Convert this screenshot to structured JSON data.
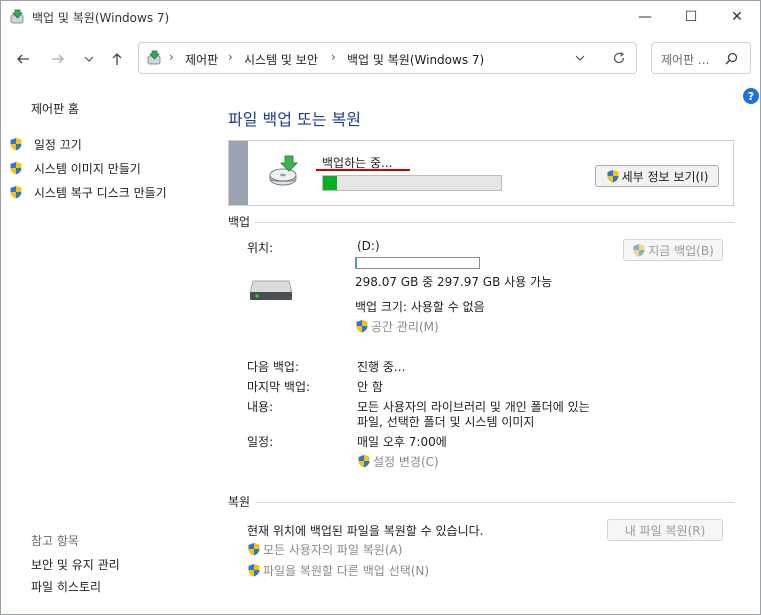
{
  "window": {
    "title": "백업 및 복원(Windows 7)",
    "minimize": "—",
    "maximize": "☐",
    "close": "✕"
  },
  "address": {
    "breadcrumbs": [
      "제어판",
      "시스템 및 보안",
      "백업 및 복원(Windows 7)"
    ],
    "search_placeholder": "제어판 ..."
  },
  "sidebar": {
    "home": "제어판 홈",
    "items": [
      {
        "label": "일정 끄기",
        "icon": "uac-shield-icon"
      },
      {
        "label": "시스템 이미지 만들기",
        "icon": "uac-shield-icon"
      },
      {
        "label": "시스템 복구 디스크 만들기",
        "icon": "uac-shield-icon"
      }
    ],
    "see_also_title": "참고 항목",
    "see_also": [
      "보안 및 유지 관리",
      "파일 히스토리"
    ]
  },
  "main": {
    "title": "파일 백업 또는 복원",
    "status": {
      "text": "백업하는 중...",
      "progress": 0.08,
      "details_button": "세부 정보 보기(I)"
    },
    "backup": {
      "section": "백업",
      "location_label": "위치:",
      "location_value": "(D:)",
      "disk_usage": 0.0003,
      "space_text": "298.07 GB 중 297.97 GB 사용 가능",
      "size_text": "백업 크기: 사용할 수 없음",
      "manage_space": "공간 관리(M)",
      "backup_now": "지금 백업(B)",
      "next_label": "다음 백업:",
      "next_value": "진행 중...",
      "last_label": "마지막 백업:",
      "last_value": "안 함",
      "contents_label": "내용:",
      "contents_line1": "모든 사용자의 라이브러리 및 개인 폴더에 있는",
      "contents_line2": "파일, 선택한 폴더 및 시스템 이미지",
      "schedule_label": "일정:",
      "schedule_value": "매일 오후 7:00에",
      "change_settings": "설정 변경(C)"
    },
    "restore": {
      "section": "복원",
      "text": "현재 위치에 백업된 파일을 복원할 수 있습니다.",
      "restore_button": "내 파일 복원(R)",
      "restore_all": "모든 사용자의 파일 복원(A)",
      "select_other": "파일을 복원할 다른 백업 선택(N)"
    }
  },
  "colors": {
    "accent": "#1e3f8f",
    "progress": "#06b025",
    "status_band": "#9aa3b2",
    "underline": "#d40000"
  }
}
